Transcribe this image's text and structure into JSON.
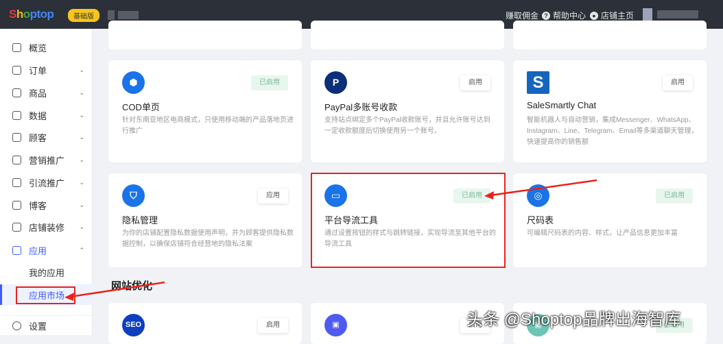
{
  "header": {
    "logo": "Shoptop",
    "plan_badge": "基础版",
    "links": [
      "赚取佣金",
      "帮助中心",
      "店铺主页"
    ]
  },
  "sidebar": {
    "items": [
      {
        "label": "概览",
        "chevron": ""
      },
      {
        "label": "订单",
        "chevron": "⌄"
      },
      {
        "label": "商品",
        "chevron": "⌄"
      },
      {
        "label": "数据",
        "chevron": "⌄"
      },
      {
        "label": "顾客",
        "chevron": "⌄"
      },
      {
        "label": "营销推广",
        "chevron": "⌄"
      },
      {
        "label": "引流推广",
        "chevron": "⌄"
      },
      {
        "label": "博客",
        "chevron": "⌄"
      },
      {
        "label": "店铺装修",
        "chevron": "⌄"
      },
      {
        "label": "应用",
        "chevron": "⌃"
      }
    ],
    "sub_items": [
      "我的应用",
      "应用市场"
    ],
    "settings": "设置"
  },
  "cards": [
    {
      "title": "COD单页",
      "desc": "针对东南亚地区电商模式，只使用移动端的产品落地页进行推广",
      "button": "已启用",
      "enabled": true,
      "icon": "box-icon",
      "color": "#1a73e8"
    },
    {
      "title": "PayPal多账号收款",
      "desc": "支持站点绑定多个PayPal收款账号，并且允许账号达到一定收款额度后切换使用另一个账号。",
      "button": "启用",
      "enabled": false,
      "icon": "paypal-icon",
      "color": "#0d2f7a"
    },
    {
      "title": "SaleSmartly Chat",
      "desc": "智能机器人与自动营销，集成Messenger、WhatsApp、Instagram、Line、Telegram、Email等多渠道聊天管理，快速提高你的销售额",
      "button": "启用",
      "enabled": false,
      "icon": "s-logo-icon",
      "color": "#1565c0"
    },
    {
      "title": "隐私管理",
      "desc": "为你的店铺配置隐私数据使用声明，并为顾客提供隐私数据控制，以确保店铺符合经营地的隐私法案",
      "button": "应用",
      "enabled": false,
      "icon": "shield-icon",
      "color": "#1a73e8"
    },
    {
      "title": "平台导流工具",
      "desc": "通过设置按钮的样式与跳转链接，实现导流至其他平台的导流工具",
      "button": "已启用",
      "enabled": true,
      "icon": "monitor-icon",
      "color": "#1a73e8"
    },
    {
      "title": "尺码表",
      "desc": "可编辑尺码表的内容、样式，让产品信息更加丰富",
      "button": "已启用",
      "enabled": true,
      "icon": "tape-icon",
      "color": "#1a73e8"
    }
  ],
  "section": "网站优化",
  "row4": [
    {
      "icon": "seo-icon",
      "icon_text": "SEO",
      "button": "启用",
      "color": "#0d3fbf"
    },
    {
      "icon": "sitemap-icon",
      "button": "启用",
      "color": "#4f5bf0"
    },
    {
      "icon": "image-icon",
      "button": "已启用",
      "color": "#6cc5b5"
    }
  ],
  "watermark": "头条 @Shoptop品牌出海智库"
}
